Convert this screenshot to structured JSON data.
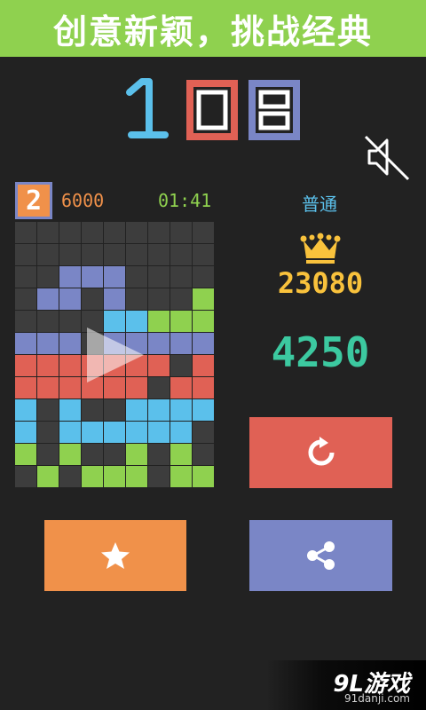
{
  "banner": {
    "text": "创意新颖，挑战经典"
  },
  "logo": {
    "text": "108",
    "colors": [
      "#5bc0eb",
      "#e06155",
      "#7a86c6"
    ]
  },
  "mute_icon": "speaker-muted-icon",
  "status": {
    "level": "2",
    "target": "6000",
    "timer": "01:41",
    "difficulty": "普通"
  },
  "best": {
    "icon": "crown-icon",
    "value": "23080"
  },
  "score": {
    "value": "4250"
  },
  "buttons": {
    "restart_icon": "restart-icon",
    "rate_icon": "star-icon",
    "share_icon": "share-icon",
    "play_icon": "play-icon"
  },
  "colors": {
    "empty": "#3d3d3d",
    "blue": "#5bc0eb",
    "red": "#e06155",
    "green": "#8fd14f",
    "purple": "#7a86c6",
    "orange": "#f0914a",
    "gold": "#f9c23c",
    "teal": "#3cc9a0"
  },
  "board": {
    "rows": [
      [
        "e",
        "e",
        "e",
        "e",
        "e",
        "e",
        "e",
        "e",
        "e"
      ],
      [
        "e",
        "e",
        "e",
        "e",
        "e",
        "e",
        "e",
        "e",
        "e"
      ],
      [
        "e",
        "e",
        "p",
        "p",
        "p",
        "e",
        "e",
        "e",
        "e"
      ],
      [
        "e",
        "p",
        "p",
        "e",
        "p",
        "e",
        "e",
        "e",
        "g"
      ],
      [
        "e",
        "e",
        "e",
        "e",
        "b",
        "b",
        "g",
        "g",
        "g"
      ],
      [
        "p",
        "p",
        "p",
        "e",
        "p",
        "p",
        "p",
        "p",
        "p"
      ],
      [
        "r",
        "r",
        "r",
        "r",
        "r",
        "r",
        "r",
        "e",
        "r"
      ],
      [
        "r",
        "r",
        "r",
        "r",
        "r",
        "r",
        "e",
        "r",
        "r"
      ],
      [
        "b",
        "e",
        "b",
        "e",
        "e",
        "b",
        "b",
        "b",
        "b"
      ],
      [
        "b",
        "e",
        "b",
        "b",
        "b",
        "b",
        "b",
        "b",
        "e"
      ],
      [
        "g",
        "e",
        "g",
        "e",
        "e",
        "g",
        "e",
        "g",
        "e"
      ],
      [
        "e",
        "g",
        "e",
        "g",
        "g",
        "g",
        "e",
        "g",
        "g"
      ]
    ]
  },
  "watermark": {
    "main": "9L游戏",
    "sub": "91danji.com"
  }
}
